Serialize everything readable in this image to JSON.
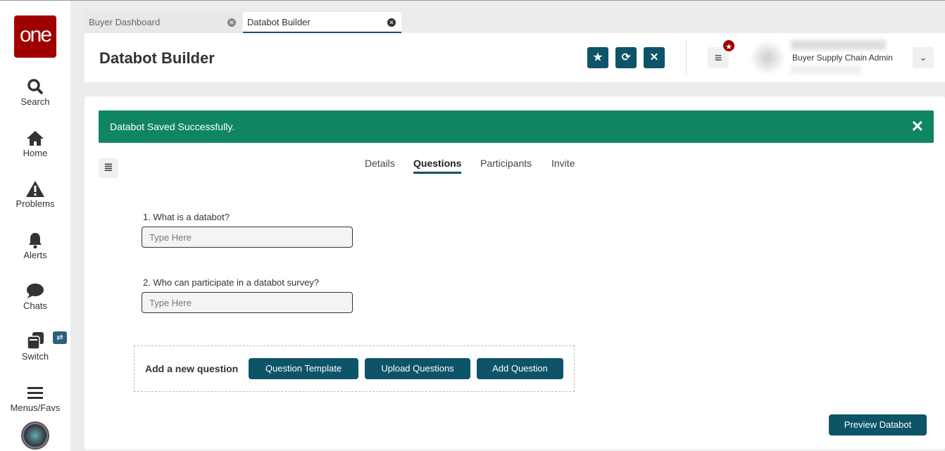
{
  "logo": "one",
  "sidebar": [
    "Search",
    "Home",
    "Problems",
    "Alerts",
    "Chats",
    "Switch",
    "Menus/Favs"
  ],
  "tabs": [
    {
      "label": "Buyer Dashboard"
    },
    {
      "label": "Databot Builder"
    }
  ],
  "header": {
    "title": "Databot Builder",
    "role": "Buyer Supply Chain Admin"
  },
  "alert": {
    "message": "Databot Saved Successfully.",
    "close": "✕"
  },
  "subtabs": [
    "Details",
    "Questions",
    "Participants",
    "Invite"
  ],
  "questions": [
    {
      "label": "1. What is a databot?",
      "placeholder": "Type Here"
    },
    {
      "label": "2. Who can participate in a databot survey?",
      "placeholder": "Type Here"
    }
  ],
  "add": {
    "label": "Add a new question",
    "template": "Question Template",
    "upload": "Upload Questions",
    "add": "Add Question"
  },
  "preview": "Preview Databot"
}
